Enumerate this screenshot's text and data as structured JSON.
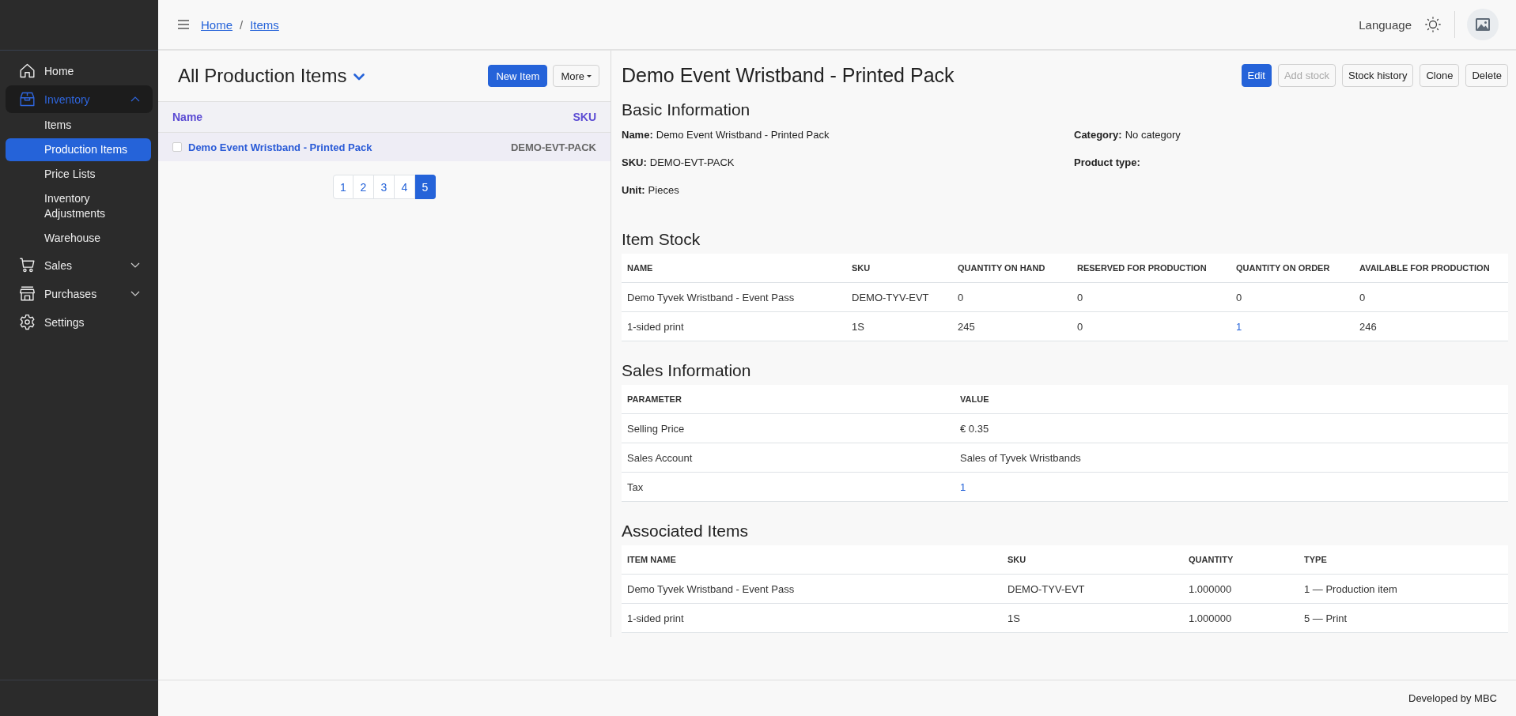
{
  "sidebar": {
    "items": [
      {
        "label": "Home",
        "kind": "link",
        "selected": false
      },
      {
        "label": "Inventory",
        "kind": "group",
        "selected": true,
        "expanded": true,
        "children": [
          {
            "label": "Items",
            "selected": false
          },
          {
            "label": "Production Items",
            "selected": true
          },
          {
            "label": "Price Lists",
            "selected": false
          },
          {
            "label": "Inventory Adjustments",
            "selected": false
          },
          {
            "label": "Warehouse",
            "selected": false
          }
        ]
      },
      {
        "label": "Sales",
        "kind": "group",
        "selected": false,
        "expanded": false
      },
      {
        "label": "Purchases",
        "kind": "group",
        "selected": false,
        "expanded": false
      },
      {
        "label": "Settings",
        "kind": "link",
        "selected": false
      }
    ]
  },
  "topbar": {
    "breadcrumb": {
      "links": [
        "Home",
        "Items"
      ],
      "separator": "/"
    },
    "language": "Language"
  },
  "list": {
    "title": "All Production Items",
    "buttons": [
      {
        "label": "New Item",
        "kind": "primary"
      },
      {
        "label": "More",
        "kind": "dropdown"
      }
    ],
    "columns": [
      "Name",
      "SKU"
    ],
    "rows": [
      {
        "name": "Demo Event Wristband - Printed Pack",
        "sku": "DEMO-EVT-PACK",
        "checked": false
      }
    ],
    "pages": [
      {
        "label": "1",
        "selected": false
      },
      {
        "label": "2",
        "selected": false
      },
      {
        "label": "3",
        "selected": false
      },
      {
        "label": "4",
        "selected": false
      },
      {
        "label": "5",
        "selected": true
      }
    ]
  },
  "detail": {
    "title": "Demo Event Wristband - Printed Pack",
    "actions": [
      {
        "label": "Edit",
        "kind": "primary",
        "disabled": false
      },
      {
        "label": "Add stock",
        "kind": "secondary",
        "disabled": true
      },
      {
        "label": "Stock history",
        "kind": "secondary",
        "disabled": false
      },
      {
        "label": "Clone",
        "kind": "secondary",
        "disabled": false
      },
      {
        "label": "Delete",
        "kind": "secondary",
        "disabled": false
      }
    ],
    "basic_information": {
      "heading": "Basic Information",
      "fields": [
        {
          "label": "Name:",
          "value": "Demo Event Wristband - Printed Pack"
        },
        {
          "label": "Category:",
          "value": "No category"
        },
        {
          "label": "SKU:",
          "value": "DEMO-EVT-PACK"
        },
        {
          "label": "Product type:"
        },
        {
          "label": "Unit:",
          "value": "Pieces"
        }
      ]
    },
    "item_stock": {
      "heading": "Item Stock",
      "columns": [
        "NAME",
        "SKU",
        "QUANTITY ON HAND",
        "RESERVED FOR PRODUCTION",
        "QUANTITY ON ORDER",
        "AVAILABLE FOR PRODUCTION"
      ],
      "rows": [
        [
          {
            "text": "Demo Tyvek Wristband - Event Pass",
            "link": false
          },
          {
            "text": "DEMO-TYV-EVT",
            "link": false
          },
          {
            "text": "0",
            "link": false
          },
          {
            "text": "0",
            "link": false
          },
          {
            "text": "0",
            "link": false
          },
          {
            "text": "0",
            "link": false
          }
        ],
        [
          {
            "text": "1-sided print",
            "link": false
          },
          {
            "text": "1S",
            "link": false
          },
          {
            "text": "245",
            "link": false
          },
          {
            "text": "0",
            "link": false
          },
          {
            "text": "1",
            "link": true
          },
          {
            "text": "246",
            "link": false
          }
        ]
      ]
    },
    "sales_information": {
      "heading": "Sales Information",
      "columns": [
        "PARAMETER",
        "VALUE"
      ],
      "rows": [
        [
          {
            "text": "Selling Price",
            "link": false
          },
          {
            "text": "€ 0.35",
            "link": false
          }
        ],
        [
          {
            "text": "Sales Account",
            "link": false
          },
          {
            "text": "Sales of Tyvek Wristbands",
            "link": false
          }
        ],
        [
          {
            "text": "Tax",
            "link": false
          },
          {
            "text": "1",
            "link": true
          }
        ]
      ]
    },
    "associated_items": {
      "heading": "Associated Items",
      "columns": [
        "ITEM NAME",
        "SKU",
        "QUANTITY",
        "TYPE"
      ],
      "rows": [
        [
          {
            "text": "Demo Tyvek Wristband - Event Pass",
            "link": false
          },
          {
            "text": "DEMO-TYV-EVT",
            "link": false
          },
          {
            "text": "1.000000",
            "link": false
          },
          {
            "text": "1 — Production item",
            "link": false
          }
        ],
        [
          {
            "text": "1-sided print",
            "link": false
          },
          {
            "text": "1S",
            "link": false
          },
          {
            "text": "1.000000",
            "link": false
          },
          {
            "text": "5 — Print",
            "link": false
          }
        ]
      ]
    }
  },
  "footer": {
    "text": "Developed by MBC"
  }
}
